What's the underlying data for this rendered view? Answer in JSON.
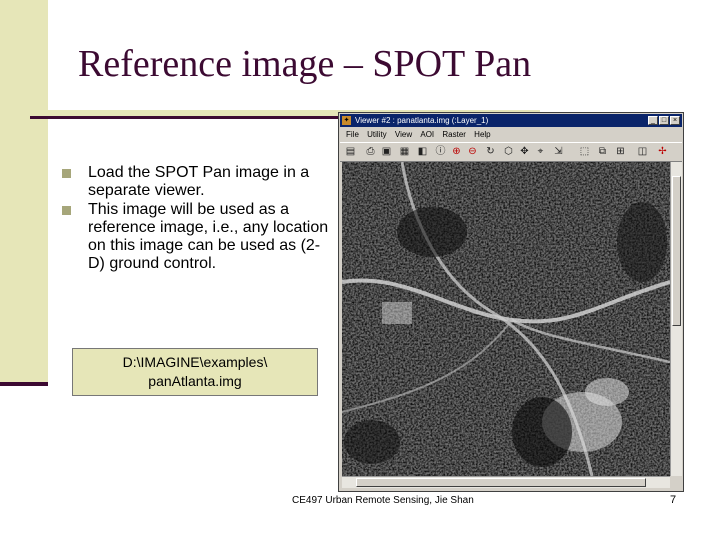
{
  "slide": {
    "title": "Reference image – SPOT Pan",
    "bullets": [
      "Load the SPOT Pan image in a separate viewer.",
      "This image will be used as a reference image, i.e., any location on this image can be used as (2-D) ground control."
    ],
    "path_line1": "D:\\IMAGINE\\examples\\",
    "path_line2": "panAtlanta.img",
    "footer": "CE497 Urban Remote Sensing, Jie Shan",
    "page_number": "7"
  },
  "viewer": {
    "title": "Viewer #2 : panatlanta.img (:Layer_1)",
    "menu": [
      "File",
      "Utility",
      "View",
      "AOI",
      "Raster",
      "Help"
    ],
    "toolbar_icons": [
      "open-icon",
      "print-icon",
      "save-icon",
      "clear-icon",
      "inquire-icon",
      "info-icon",
      "zoom-in-icon",
      "zoom-out-icon",
      "rotate-icon",
      "aoi-icon",
      "roam-icon",
      "select-icon",
      "measure-icon",
      "fit-icon",
      "arrange-icon",
      "raster-icon"
    ],
    "controls": {
      "minimize": "_",
      "maximize": "□",
      "close": "×"
    }
  },
  "colors": {
    "accent_dark": "#3c0a32",
    "band": "#e6e6b8",
    "bullet": "#a6a67a",
    "titlebar": "#0a246a"
  }
}
